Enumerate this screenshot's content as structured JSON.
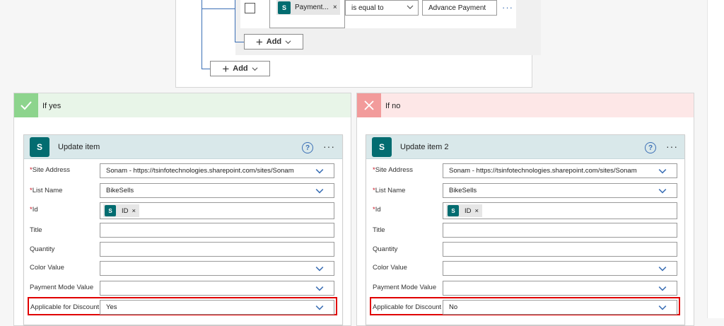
{
  "condition": {
    "token_label": "Payment...",
    "token_remove": "×",
    "operator": "is equal to",
    "value": "Advance Payment",
    "more": "···",
    "add_inner_label": "Add",
    "add_outer_label": "Add"
  },
  "branches": {
    "yes": {
      "header_label": "If yes",
      "action": {
        "title": "Update item",
        "help": "?",
        "more": "···",
        "fields": {
          "site_address": {
            "label": "Site Address",
            "value": "Sonam - https://tsinfotechnologies.sharepoint.com/sites/Sonam"
          },
          "list_name": {
            "label": "List Name",
            "value": "BikeSells"
          },
          "id": {
            "label": "Id",
            "token": "ID",
            "token_remove": "×"
          },
          "title": {
            "label": "Title",
            "value": ""
          },
          "quantity": {
            "label": "Quantity",
            "value": ""
          },
          "color_value": {
            "label": "Color Value",
            "value": ""
          },
          "payment_mode_value": {
            "label": "Payment Mode Value",
            "value": ""
          },
          "applicable_for_discount": {
            "label": "Applicable for Discount",
            "value": "Yes"
          }
        }
      }
    },
    "no": {
      "header_label": "If no",
      "action": {
        "title": "Update item 2",
        "help": "?",
        "more": "···",
        "fields": {
          "site_address": {
            "label": "Site Address",
            "value": "Sonam - https://tsinfotechnologies.sharepoint.com/sites/Sonam"
          },
          "list_name": {
            "label": "List Name",
            "value": "BikeSells"
          },
          "id": {
            "label": "Id",
            "token": "ID",
            "token_remove": "×"
          },
          "title": {
            "label": "Title",
            "value": ""
          },
          "quantity": {
            "label": "Quantity",
            "value": ""
          },
          "color_value": {
            "label": "Color Value",
            "value": ""
          },
          "payment_mode_value": {
            "label": "Payment Mode Value",
            "value": ""
          },
          "applicable_for_discount": {
            "label": "Applicable for Discount",
            "value": "No"
          }
        }
      }
    }
  },
  "colors": {
    "accent": "#3b6fb5",
    "sharepoint": "#036c70",
    "yes_header": "#e8f5e8",
    "no_header": "#fde7e7",
    "highlight": "#e00000"
  },
  "icons": {
    "sharepoint": "sharepoint-icon",
    "checkmark": "checkmark-icon",
    "close": "close-icon",
    "chevron": "chevron-down-icon",
    "plus": "plus-icon",
    "help": "help-icon",
    "more": "more-options-icon"
  }
}
